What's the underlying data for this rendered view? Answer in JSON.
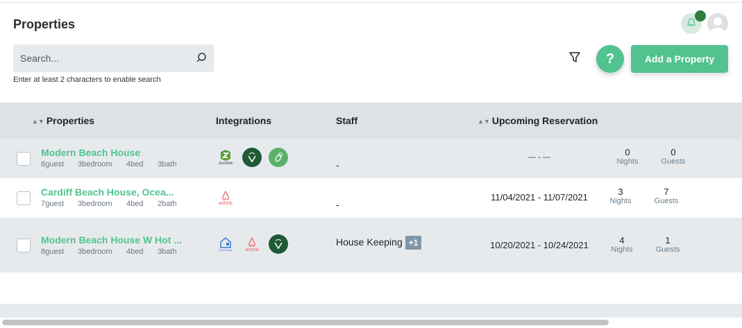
{
  "header": {
    "title": "Properties",
    "search_placeholder": "Search...",
    "search_hint": "Enter at least 2 characters to enable search",
    "help_label": "?",
    "add_label": "Add a Property"
  },
  "colors": {
    "accent": "#52c28f",
    "header_bg": "#dde2e6"
  },
  "columns": {
    "properties": "Properties",
    "integrations": "Integrations",
    "staff": "Staff",
    "reservation": "Upcoming Reservation"
  },
  "rows": [
    {
      "name": "Modern Beach House",
      "guest": "8guest",
      "bedroom": "3bedroom",
      "bed": "4bed",
      "bath": "3bath",
      "integrations": [
        "ZenVRM",
        "vrbo-v",
        "bee"
      ],
      "staff": "-",
      "dates": "--- - ---",
      "nights": "0",
      "nights_label": "Nights",
      "guests": "0",
      "guests_label": "Guests"
    },
    {
      "name": "Cardiff Beach House, Ocea...",
      "guest": "7guest",
      "bedroom": "3bedroom",
      "bed": "4bed",
      "bath": "2bath",
      "integrations": [
        "airbnb"
      ],
      "staff": "-",
      "dates": "11/04/2021 - 11/07/2021",
      "nights": "3",
      "nights_label": "Nights",
      "guests": "7",
      "guests_label": "Guests"
    },
    {
      "name": "Modern Beach House W Hot ...",
      "guest": "8guest",
      "bedroom": "3bedroom",
      "bed": "4bed",
      "bath": "3bath",
      "integrations": [
        "HomeAway",
        "airbnb",
        "vrbo-v"
      ],
      "staff": "House Keeping",
      "staff_extra": "+1",
      "dates": "10/20/2021 - 10/24/2021",
      "nights": "4",
      "nights_label": "Nights",
      "guests": "1",
      "guests_label": "Guests"
    }
  ]
}
